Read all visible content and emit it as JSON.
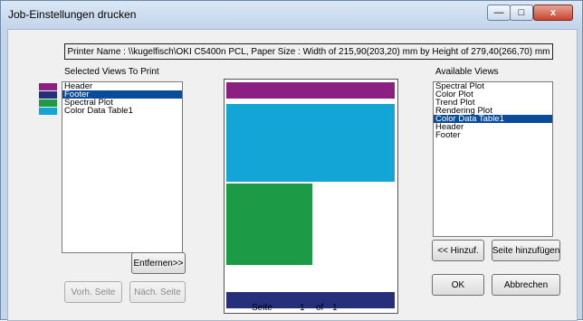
{
  "window": {
    "title": "Job-Einstellungen drucken"
  },
  "titlebar_buttons": {
    "minimize": "—",
    "maximize": "□",
    "close": "x"
  },
  "printer_info": "Printer Name : \\\\kugelfisch\\OKI C5400n PCL, Paper Size : Width of 215,90(203,20) mm by Height of 279,40(266,70) mm",
  "selected_views": {
    "label": "Selected Views To Print",
    "items": [
      {
        "label": "Header",
        "selected": false,
        "color": "#8b1f82"
      },
      {
        "label": "Footer",
        "selected": true,
        "color": "#26307a"
      },
      {
        "label": "Spectral Plot",
        "selected": false,
        "color": "#1d9a45"
      },
      {
        "label": "Color Data Table1",
        "selected": false,
        "color": "#14a5d7"
      }
    ]
  },
  "available_views": {
    "label": "Available Views",
    "items": [
      {
        "label": "Spectral Plot",
        "selected": false
      },
      {
        "label": "Color Plot",
        "selected": false
      },
      {
        "label": "Trend Plot",
        "selected": false
      },
      {
        "label": "Rendering Plot",
        "selected": false
      },
      {
        "label": "Color Data Table1",
        "selected": true
      },
      {
        "label": "Header",
        "selected": false
      },
      {
        "label": "Footer",
        "selected": false
      }
    ]
  },
  "buttons": {
    "remove": "Entfernen>>",
    "prev_page": "Vorh. Seite",
    "next_page": "Näch. Seite",
    "add": "<< Hinzuf.",
    "add_page": "Seite hinzufügen",
    "ok": "OK",
    "cancel": "Abbrechen"
  },
  "pager": {
    "label": "Seite",
    "current": "1",
    "of": "of",
    "total": "1"
  },
  "preview_colors": {
    "header": "#8b1f82",
    "color_data_table": "#14a5d7",
    "spectral_plot": "#1d9a45",
    "footer": "#26307a"
  }
}
